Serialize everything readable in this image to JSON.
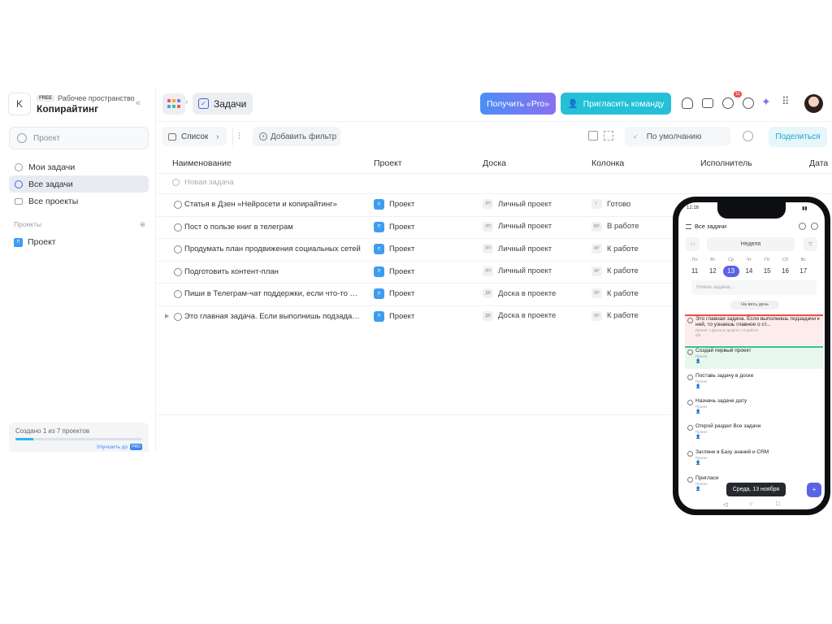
{
  "workspace": {
    "avatar_letter": "K",
    "plan_badge": "FREE",
    "label": "Рабочее пространство",
    "name": "Копирайтинг"
  },
  "sidebar": {
    "search_placeholder": "Проект",
    "items": [
      {
        "label": "Мои задачи",
        "icon": "my-tasks-icon"
      },
      {
        "label": "Все задачи",
        "icon": "all-tasks-icon",
        "active": true
      },
      {
        "label": "Все проекты",
        "icon": "folder-icon"
      }
    ],
    "section_label": "Проекты",
    "project": {
      "badge": "П",
      "label": "Проект"
    },
    "footer": {
      "text": "Создано 1 из 7 проектов",
      "progress": 0.14,
      "upgrade": "Улучшить до",
      "upgrade_badge": "PRO"
    }
  },
  "topbar": {
    "breadcrumb": "Задачи",
    "pro_button": "Получить «Pro»",
    "invite_button": "Пригласить команду",
    "notif_count": "11"
  },
  "toolbar": {
    "view": "Список",
    "add_filter": "Добавить фильтр",
    "sort": "По умолчанию",
    "share": "Поделиться"
  },
  "table": {
    "columns": [
      "Наименование",
      "Проект",
      "Доска",
      "Колонка",
      "Исполнитель",
      "Дата"
    ],
    "new_task": "Новая задача",
    "rows": [
      {
        "name": "Статья в Дзен «Нейросети и копирайтинг»",
        "project_badge": "П",
        "project": "Проект",
        "board_tag": "ЛП",
        "board": "Личный проект",
        "column_tag": "Г",
        "column": "Готово"
      },
      {
        "name": "Пост о пользе книг в телеграм",
        "project_badge": "П",
        "project": "Проект",
        "board_tag": "ЛП",
        "board": "Личный проект",
        "column_tag": "ВР",
        "column": "В работе"
      },
      {
        "name": "Продумать план продвижения социальных сетей",
        "project_badge": "П",
        "project": "Проект",
        "board_tag": "ЛП",
        "board": "Личный проект",
        "column_tag": "КР",
        "column": "К работе"
      },
      {
        "name": "Подготовить контент-план",
        "project_badge": "П",
        "project": "Проект",
        "board_tag": "ЛП",
        "board": "Личный проект",
        "column_tag": "КР",
        "column": "К работе"
      },
      {
        "name": "Пиши в Телеграм-чат поддержки, если что-то не понятно",
        "project_badge": "П",
        "project": "Проект",
        "board_tag": "ДВ",
        "board": "Доска в проекте",
        "column_tag": "КР",
        "column": "К работе"
      },
      {
        "name": "Это главная задача. Если выполнишь подзадачи к ней",
        "project_badge": "П",
        "project": "Проект",
        "board_tag": "ДВ",
        "board": "Доска в проекте",
        "column_tag": "КР",
        "column": "К работе"
      }
    ]
  },
  "phone": {
    "time": "12:16",
    "title": "Все задачи",
    "week": "Неделя",
    "days": [
      {
        "n": "Пн",
        "d": "11"
      },
      {
        "n": "Вт",
        "d": "12"
      },
      {
        "n": "Ср",
        "d": "13"
      },
      {
        "n": "Чт",
        "d": "14"
      },
      {
        "n": "Пт",
        "d": "15"
      },
      {
        "n": "Сб",
        "d": "16"
      },
      {
        "n": "Вс",
        "d": "17"
      }
    ],
    "selected_day": 2,
    "new_task": "Новая задача...",
    "all_day": "На весь день",
    "tasks": [
      {
        "text": "Это главная задача. Если выполнишь подзадачи к ней, то узнаешь главное о ст...",
        "meta": "Проект > Доска в проекте > К работе",
        "sub": "0/3"
      },
      {
        "text": "Создай первый проект",
        "meta": "Проект"
      },
      {
        "text": "Поставь задачу в доске",
        "meta": "Проект"
      },
      {
        "text": "Назначь задаче дату",
        "meta": "Проект"
      },
      {
        "text": "Открой раздел Все задачи",
        "meta": "Проект"
      },
      {
        "text": "Загляни в Базу знаний и CRM",
        "meta": "Проект"
      },
      {
        "text": "Пригласи",
        "meta": "Проект"
      }
    ],
    "toast": "Среда, 13 ноября",
    "colors": {
      "accent": "#5a63e6"
    }
  },
  "colors": {
    "primary_blue": "#3d9df0",
    "cyan": "#24c0d8",
    "active_bg": "#e9ebf2"
  }
}
